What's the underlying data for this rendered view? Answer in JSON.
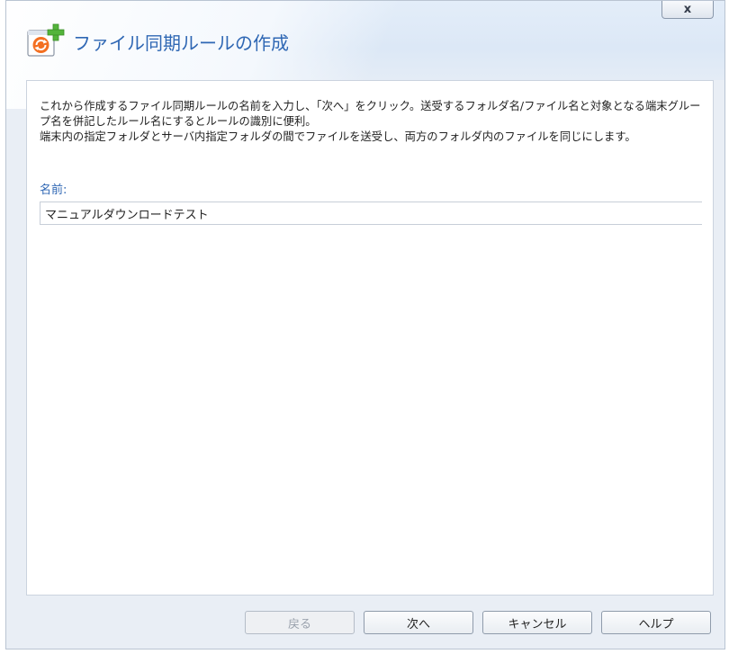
{
  "window": {
    "title": "ファイル同期ルールの作成",
    "close_glyph": "x"
  },
  "content": {
    "description_lines": [
      "これから作成するファイル同期ルールの名前を入力し、「次へ」をクリック。送受するフォルダ名/ファイル名と対象となる端末グループ名を併記したルール名にするとルールの識別に便利。",
      "端末内の指定フォルダとサーバ内指定フォルダの間でファイルを送受し、両方のフォルダ内のファイルを同じにします。"
    ],
    "name_label": "名前:",
    "name_value": "マニュアルダウンロードテスト"
  },
  "footer": {
    "back_label": "戻る",
    "back_enabled": false,
    "next_label": "次へ",
    "cancel_label": "キャンセル",
    "help_label": "ヘルプ"
  },
  "icons": {
    "app": "sync-add-icon",
    "close": "close-icon"
  },
  "colors": {
    "title": "#2f67b4",
    "icon_orange": "#f36f21",
    "icon_green": "#53b43a"
  }
}
